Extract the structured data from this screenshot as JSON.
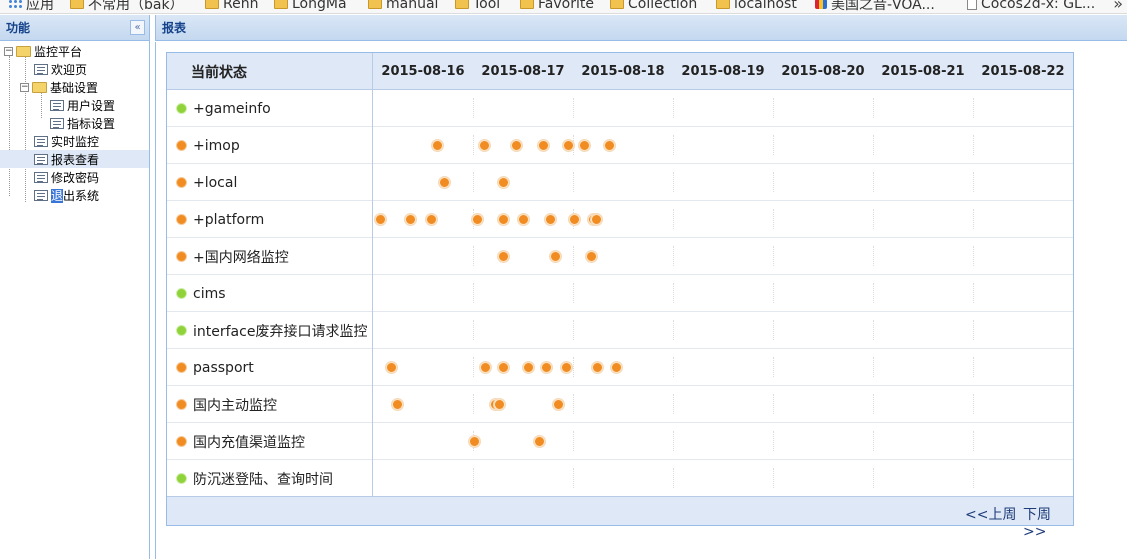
{
  "bookmarks": [
    {
      "icon": "apps-icon",
      "label": "应用"
    },
    {
      "icon": "folder-icon",
      "label": "不常用（bak）"
    },
    {
      "icon": "folder-icon",
      "label": "Renn"
    },
    {
      "icon": "folder-icon",
      "label": "LongMa"
    },
    {
      "icon": "folder-icon",
      "label": "manual"
    },
    {
      "icon": "folder-icon",
      "label": "Tool"
    },
    {
      "icon": "folder-icon",
      "label": "Favorite"
    },
    {
      "icon": "folder-icon",
      "label": "Collection"
    },
    {
      "icon": "folder-icon",
      "label": "localhost"
    },
    {
      "icon": "voa-icon",
      "label": "美国之音-VOA..."
    },
    {
      "icon": "page-icon",
      "label": "Cocos2d-x: GL..."
    }
  ],
  "sidebar": {
    "title": "功能",
    "collapse_label": "«",
    "tree": {
      "root": "监控平台",
      "welcome": "欢迎页",
      "settings": "基础设置",
      "user_settings": "用户设置",
      "metric_settings": "指标设置",
      "realtime": "实时监控",
      "reports": "报表查看",
      "password": "修改密码",
      "logout_hl": "退",
      "logout_rest": "出系统"
    }
  },
  "main": {
    "title": "报表",
    "status_header": "当前状态",
    "dates": [
      "2015-08-16",
      "2015-08-17",
      "2015-08-18",
      "2015-08-19",
      "2015-08-20",
      "2015-08-21",
      "2015-08-22"
    ],
    "prev_week": "<<上周",
    "next_week": "下周>>",
    "colors": {
      "ok": "#8fd23a",
      "alert": "#f08c22",
      "event": "#f08c22"
    },
    "rows": [
      {
        "label": "+gameinfo",
        "status": "ok",
        "events": []
      },
      {
        "label": "+imop",
        "status": "alert",
        "events": [
          0.65,
          1.12,
          1.44,
          1.71,
          1.96,
          2.12,
          2.37
        ]
      },
      {
        "label": "+local",
        "status": "alert",
        "events": [
          0.72,
          1.31
        ]
      },
      {
        "label": "+platform",
        "status": "alert",
        "events": [
          0.08,
          0.38,
          0.59,
          1.05,
          1.31,
          1.51,
          1.78,
          2.02,
          2.21,
          2.24
        ]
      },
      {
        "label": "+国内网络监控",
        "status": "alert",
        "events": [
          1.31,
          1.83,
          2.19
        ]
      },
      {
        "label": "cims",
        "status": "ok",
        "events": []
      },
      {
        "label": "interface废弃接口请求监控",
        "status": "ok",
        "events": []
      },
      {
        "label": "passport",
        "status": "alert",
        "events": [
          0.19,
          1.13,
          1.31,
          1.56,
          1.74,
          1.94,
          2.25,
          2.44
        ]
      },
      {
        "label": "国内主动监控",
        "status": "alert",
        "events": [
          0.25,
          1.23,
          1.27,
          1.86
        ]
      },
      {
        "label": "国内充值渠道监控",
        "status": "alert",
        "events": [
          1.02,
          1.67
        ]
      },
      {
        "label": "防沉迷登陆、查询时间",
        "status": "ok",
        "events": []
      }
    ]
  }
}
